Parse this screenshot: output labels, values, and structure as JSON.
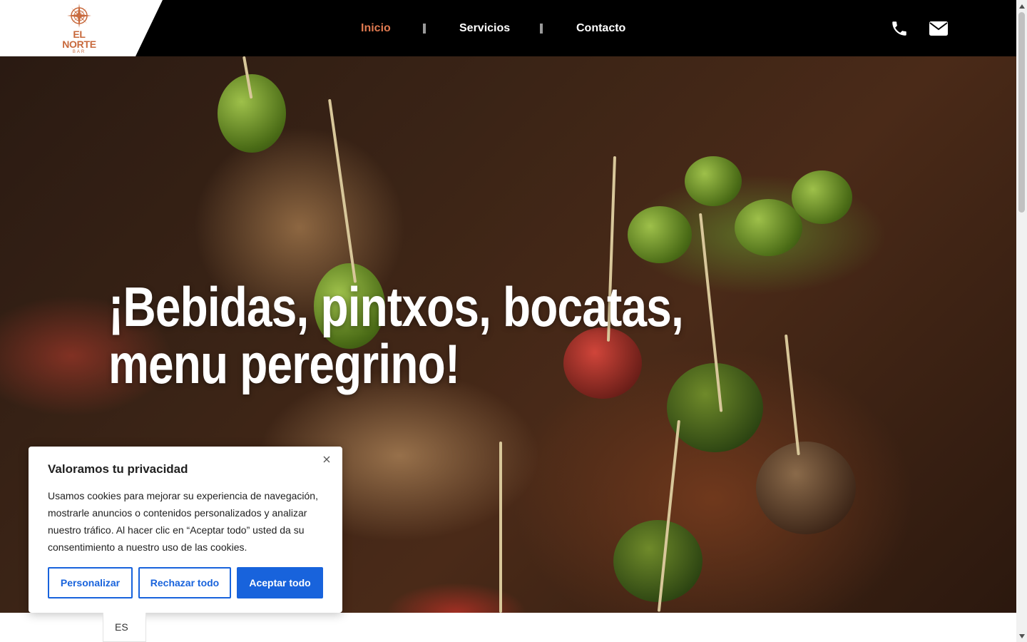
{
  "header": {
    "logo": {
      "brand": "EL NORTE",
      "sub": "BAR",
      "icon": "compass-icon"
    },
    "nav": [
      {
        "label": "Inicio",
        "active": true
      },
      {
        "label": "Servicios",
        "active": false
      },
      {
        "label": "Contacto",
        "active": false
      }
    ],
    "icons": [
      "phone-icon",
      "envelope-icon"
    ]
  },
  "hero": {
    "title": "¡Bebidas, pintxos, bocatas, menu peregrino!"
  },
  "cookie_banner": {
    "title": "Valoramos tu privacidad",
    "body": "Usamos cookies para mejorar su experiencia de navegación, mostrarle anuncios o contenidos personalizados y analizar nuestro tráfico. Al hacer clic en “Aceptar todo” usted da su consentimiento a nuestro uso de las cookies.",
    "buttons": {
      "customize": "Personalizar",
      "reject": "Rechazar todo",
      "accept": "Aceptar todo"
    },
    "close_icon": "close-icon"
  },
  "language": {
    "current": "ES"
  },
  "colors": {
    "header_bg": "#000000",
    "nav_active": "#e07a50",
    "brand": "#c8693c",
    "cookie_accent": "#1863dc"
  }
}
